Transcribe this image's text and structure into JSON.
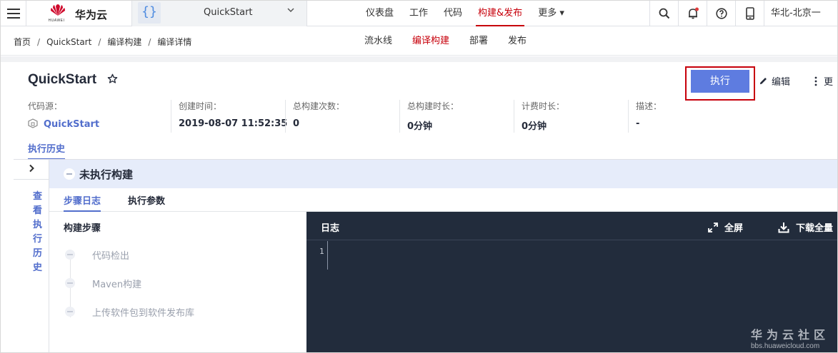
{
  "topnav": {
    "logo_subtext": "HUAWEI",
    "brand": "华为云",
    "project_name": "QuickStart",
    "items": [
      {
        "label": "仪表盘",
        "active": false
      },
      {
        "label": "工作",
        "active": false
      },
      {
        "label": "代码",
        "active": false
      },
      {
        "label": "构建&发布",
        "active": true
      },
      {
        "label": "更多 ▾",
        "active": false
      }
    ],
    "region": "华北-北京一",
    "icons": [
      "search-icon",
      "bell-icon",
      "help-icon",
      "mobile-icon"
    ]
  },
  "breadcrumb": [
    "首页",
    "QuickStart",
    "编译构建",
    "编译详情"
  ],
  "subtabs": [
    {
      "label": "流水线",
      "active": false
    },
    {
      "label": "编译构建",
      "active": true
    },
    {
      "label": "部署",
      "active": false
    },
    {
      "label": "发布",
      "active": false
    }
  ],
  "header": {
    "title": "QuickStart",
    "run_label": "执行",
    "edit_label": "编辑",
    "more_label": "更",
    "meta": [
      {
        "label": "代码源：",
        "value": "QuickStart"
      },
      {
        "label": "创建时间：",
        "value": "2019-08-07 11:52:35"
      },
      {
        "label": "总构建次数：",
        "value": "0"
      },
      {
        "label": "总构建时长：",
        "value": "0分钟"
      },
      {
        "label": "计费时长：",
        "value": "0分钟"
      },
      {
        "label": "描述：",
        "value": "-"
      }
    ],
    "history_tab": "执行历史"
  },
  "left_panel": {
    "chevron": ">",
    "vertical_text": "查看执行历史"
  },
  "build": {
    "status_title": "未执行构建",
    "tabs": [
      {
        "label": "步骤日志",
        "active": true
      },
      {
        "label": "执行参数",
        "active": false
      }
    ],
    "steps_title": "构建步骤",
    "steps": [
      "代码检出",
      "Maven构建",
      "上传软件包到软件发布库"
    ]
  },
  "log": {
    "title": "日志",
    "fullscreen_label": "全屏",
    "download_label": "下载全量",
    "line_numbers": [
      "1"
    ]
  },
  "watermark": {
    "line1": "华为云社区",
    "line2": "bbs.huaweicloud.com"
  },
  "colors": {
    "brand_red": "#c7000b",
    "primary": "#5e7ce0",
    "link": "#526ecc",
    "log_bg": "#222c3c"
  }
}
